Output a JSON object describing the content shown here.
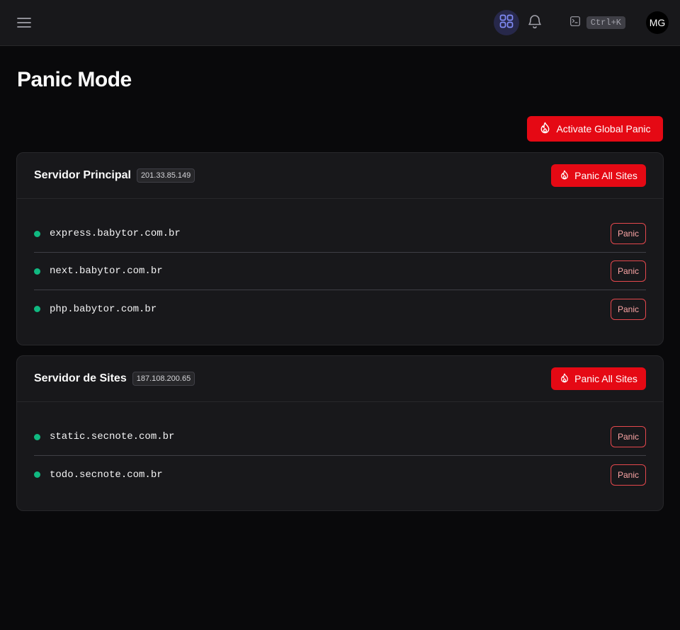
{
  "header": {
    "menu_icon": "hamburger-icon",
    "apps_icon": "grid-icon",
    "bell_icon": "bell-icon",
    "terminal_icon": "terminal-icon",
    "shortcut": "Ctrl+K",
    "avatar_initials": "MG"
  },
  "page": {
    "title": "Panic Mode",
    "global_button_label": "Activate Global Panic",
    "button_icon": "flame-icon"
  },
  "servers": [
    {
      "name": "Servidor Principal",
      "ip": "201.33.85.149",
      "panic_all_label": "Panic All Sites",
      "sites": [
        {
          "domain": "express.babytor.com.br",
          "status": "online",
          "panic_label": "Panic"
        },
        {
          "domain": "next.babytor.com.br",
          "status": "online",
          "panic_label": "Panic"
        },
        {
          "domain": "php.babytor.com.br",
          "status": "online",
          "panic_label": "Panic"
        }
      ]
    },
    {
      "name": "Servidor de Sites",
      "ip": "187.108.200.65",
      "panic_all_label": "Panic All Sites",
      "sites": [
        {
          "domain": "static.secnote.com.br",
          "status": "online",
          "panic_label": "Panic"
        },
        {
          "domain": "todo.secnote.com.br",
          "status": "online",
          "panic_label": "Panic"
        }
      ]
    }
  ],
  "colors": {
    "danger": "#e50914",
    "online": "#10b981",
    "accent": "#6366f1"
  }
}
